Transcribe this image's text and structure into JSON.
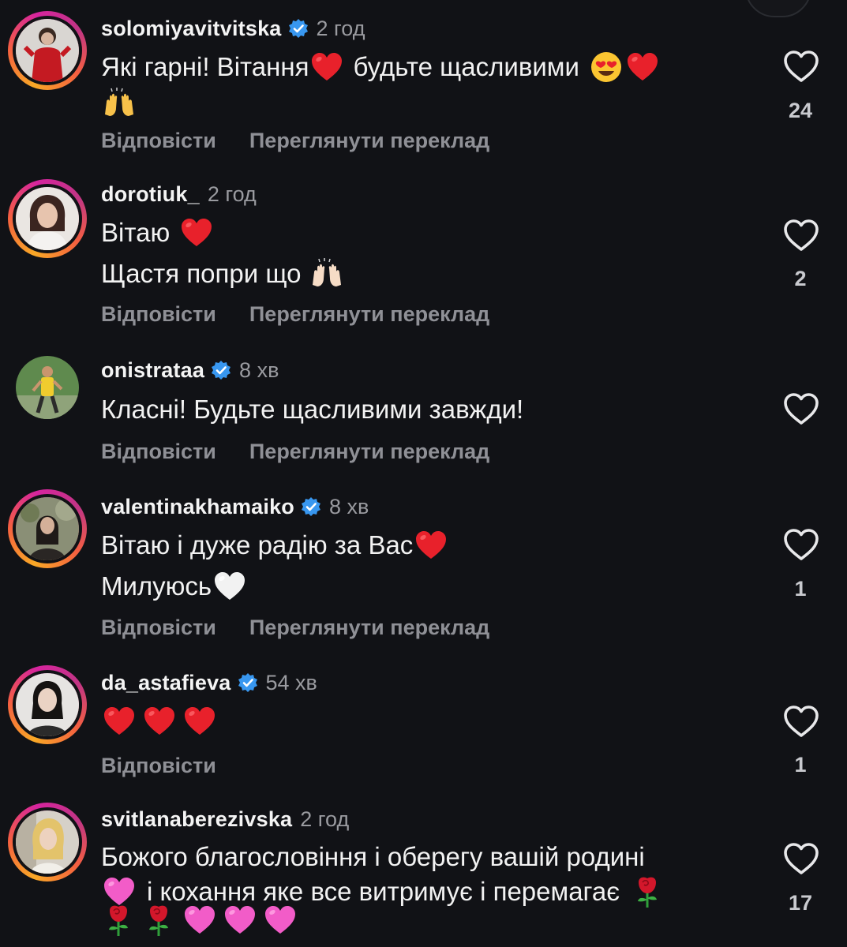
{
  "ui": {
    "reply_label": "Відповісти",
    "translate_label": "Переглянути переклад",
    "like_icon": "heart-outline-icon",
    "verified_icon": "verified-badge-icon",
    "accent_colors": {
      "background": "#111216",
      "secondary_text": "#9a9ba0",
      "verified_blue": "#3897f0"
    }
  },
  "comments": [
    {
      "username": "solomiyavitvitska",
      "verified": true,
      "time": "2 год",
      "lines": [
        "Які гарні! Вітання",
        "будьте щасливими"
      ],
      "emojis": [
        "red-heart",
        "heart-eyes-face",
        "red-heart",
        "raising-hands"
      ],
      "likes": "24",
      "has_translate": true
    },
    {
      "username": "dorotiuk_",
      "verified": false,
      "time": "2 год",
      "lines": [
        "Вітаю",
        "Щастя попри що"
      ],
      "emojis": [
        "red-heart",
        "raising-hands"
      ],
      "likes": "2",
      "has_translate": true
    },
    {
      "username": "onistrataa",
      "verified": true,
      "time": "8 хв",
      "lines": [
        "Класні! Будьте щасливими завжди!"
      ],
      "emojis": [],
      "likes": "",
      "has_translate": true
    },
    {
      "username": "valentinakhamaiko",
      "verified": true,
      "time": "8 хв",
      "lines": [
        "Вітаю і дуже радію за Вас",
        "Милуюсь"
      ],
      "emojis": [
        "red-heart",
        "white-heart"
      ],
      "likes": "1",
      "has_translate": true
    },
    {
      "username": "da_astafieva",
      "verified": true,
      "time": "54 хв",
      "lines": [],
      "emojis": [
        "red-heart",
        "red-heart",
        "red-heart"
      ],
      "likes": "1",
      "has_translate": false
    },
    {
      "username": "svitlanaberezivska",
      "verified": false,
      "time": "2 год",
      "lines": [
        "Божого благословіння і оберегу вашій родині",
        "і кохання яке все витримує і перемагає"
      ],
      "emojis": [
        "pink-heart",
        "rose",
        "rose",
        "rose",
        "pink-heart",
        "pink-heart",
        "pink-heart"
      ],
      "likes": "17",
      "has_translate": false
    }
  ]
}
